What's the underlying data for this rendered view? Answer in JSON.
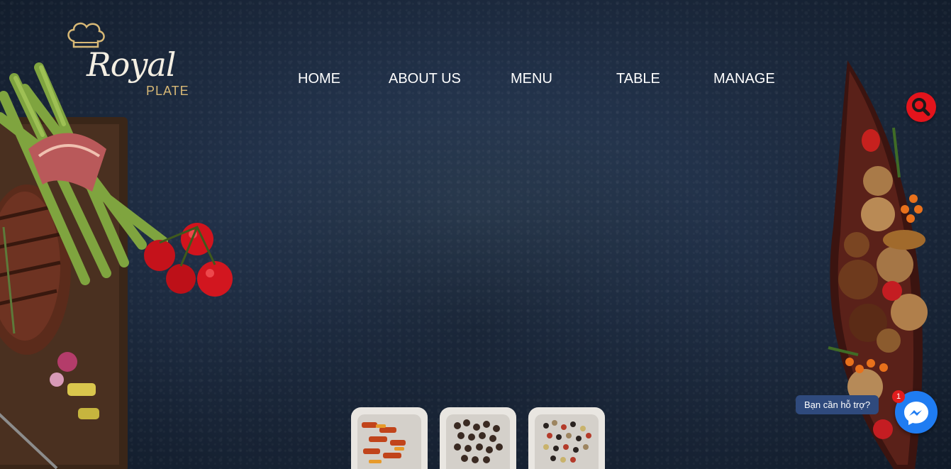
{
  "logo": {
    "title": "Royal",
    "subtitle": "PLATE"
  },
  "nav": {
    "items": [
      {
        "label": "HOME"
      },
      {
        "label": "ABOUT US"
      },
      {
        "label": "MENU"
      },
      {
        "label": "TABLE"
      },
      {
        "label": "MANAGE"
      }
    ]
  },
  "icons": {
    "search": "search-icon",
    "chef_hat": "chef-hat-icon",
    "messenger": "messenger-icon"
  },
  "chat": {
    "prompt": "Bạn cần hỗ trợ?",
    "unread_count": "1"
  },
  "colors": {
    "background": "#1b2a3d",
    "nav_text": "#ffffff",
    "search_button": "#e3141c",
    "messenger": "#1f7cf2",
    "chat_label": "#2f4a7d",
    "logo_accent": "#d7b876"
  }
}
